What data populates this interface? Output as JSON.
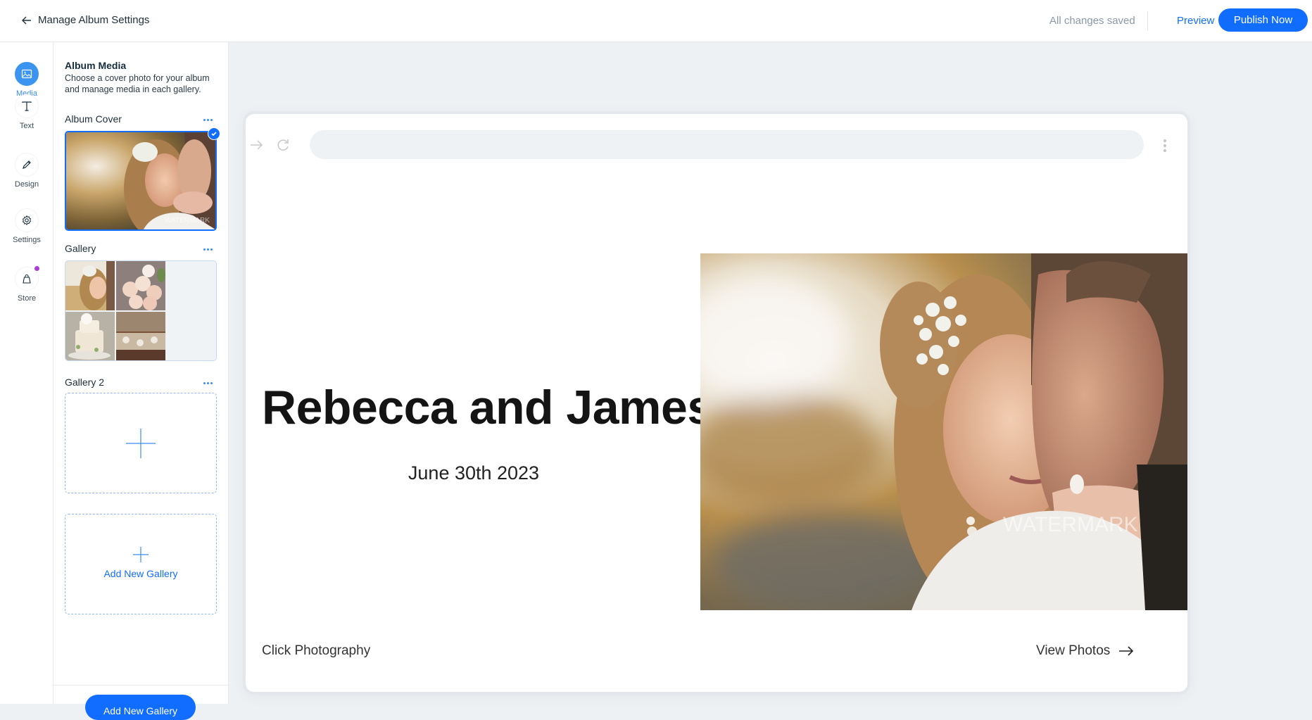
{
  "header": {
    "title": "Manage Album Settings",
    "saved_status": "All changes saved",
    "preview_label": "Preview",
    "publish_label": "Publish Now"
  },
  "nav": {
    "items": [
      {
        "label": "Media",
        "icon": "image-icon",
        "active": true
      },
      {
        "label": "Text",
        "icon": "text-icon",
        "active": false
      },
      {
        "label": "Design",
        "icon": "pencil-icon",
        "active": false
      },
      {
        "label": "Settings",
        "icon": "gear-icon",
        "active": false
      },
      {
        "label": "Store",
        "icon": "shopping-bag-icon",
        "active": false,
        "notification": true
      }
    ],
    "notification_color": "#a83fd6"
  },
  "panel": {
    "title": "Album Media",
    "description": "Choose a cover photo for your album and manage media in each gallery.",
    "cover_label": "Album Cover",
    "gallery_label": "Gallery",
    "gallery2_label": "Gallery 2",
    "add_gallery_label": "Add New Gallery",
    "footer_button_label": "Add New Gallery",
    "watermark": "WATERMARK"
  },
  "preview": {
    "title": "Rebecca and James",
    "date": "June 30th 2023",
    "brand": "Click Photography",
    "view_photos_label": "View Photos",
    "watermark": "WATERMARK"
  },
  "colors": {
    "accent": "#116dff",
    "nav_active": "#3b95f0"
  }
}
